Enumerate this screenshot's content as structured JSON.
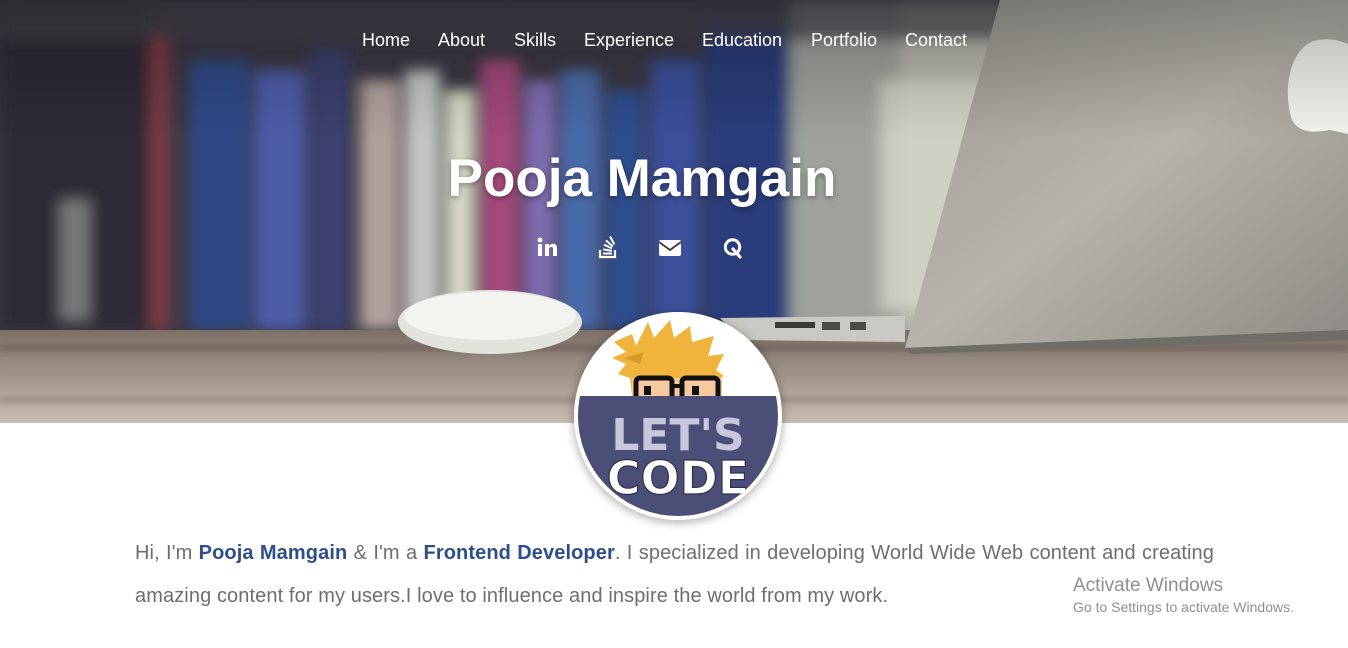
{
  "nav": {
    "items": [
      "Home",
      "About",
      "Skills",
      "Experience",
      "Education",
      "Portfolio",
      "Contact"
    ]
  },
  "hero": {
    "title": "Pooja Mamgain"
  },
  "social": {
    "icons": [
      "linkedin-icon",
      "stackoverflow-icon",
      "envelope-icon",
      "quora-icon"
    ]
  },
  "avatar": {
    "line1": "LET'S",
    "line2": "CODE"
  },
  "intro": {
    "p1": "Hi, I'm ",
    "name": "Pooja Mamgain",
    "p2": " & I'm a ",
    "role": "Frontend Developer",
    "p3": ". I specialized in developing World Wide Web content and creating amazing content for my users.I love to influence and inspire the world from my work."
  },
  "watermark": {
    "title": "Activate Windows",
    "subtitle": "Go to Settings to activate Windows."
  },
  "colors": {
    "accent": "#2c4f8c",
    "body_text": "#6e6e6e",
    "avatar_band": "#4b4f78"
  }
}
